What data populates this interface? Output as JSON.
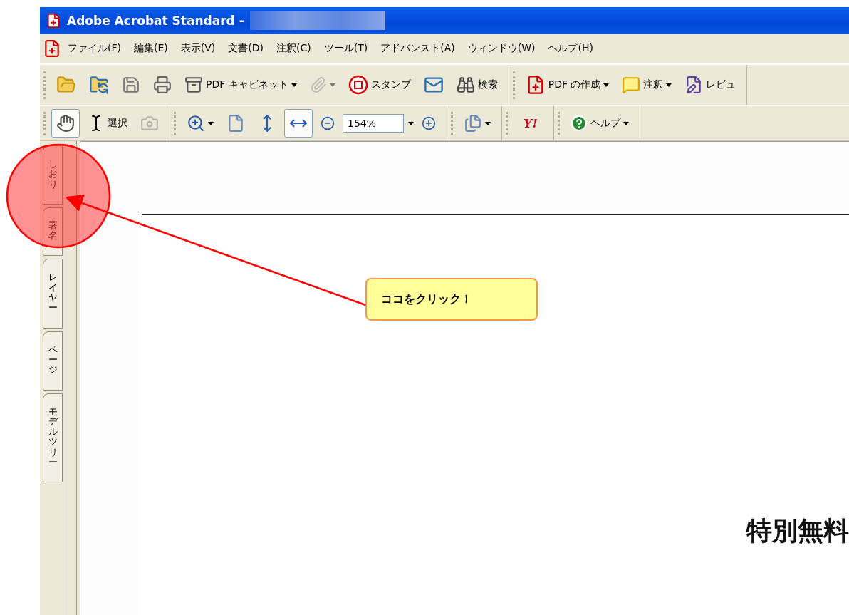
{
  "window": {
    "title": "Adobe Acrobat Standard -"
  },
  "menu": [
    "ファイル(F)",
    "編集(E)",
    "表示(V)",
    "文書(D)",
    "注釈(C)",
    "ツール(T)",
    "アドバンスト(A)",
    "ウィンドウ(W)",
    "ヘルプ(H)"
  ],
  "toolbar_1": [
    {
      "items": [
        {
          "kind": "button"
        },
        {
          "kind": "button"
        },
        {
          "kind": "button"
        },
        {
          "kind": "button"
        },
        {
          "kind": "button",
          "label": "PDF キャビネット",
          "dropdown": true
        },
        {
          "kind": "button",
          "dropdown": true,
          "disabled": true
        },
        {
          "kind": "button",
          "label": "スタンプ"
        },
        {
          "kind": "button"
        },
        {
          "kind": "button",
          "label": "検索"
        }
      ]
    },
    {
      "items": [
        {
          "kind": "button",
          "label": "PDF の作成",
          "dropdown": true
        },
        {
          "kind": "button",
          "label": "注釈",
          "dropdown": true
        },
        {
          "kind": "button",
          "label": "レビュ"
        }
      ]
    }
  ],
  "toolbar_2": [
    {
      "items": [
        {
          "kind": "button",
          "selected": true
        },
        {
          "kind": "button",
          "label": "選択",
          "selected": false
        },
        {
          "kind": "button",
          "disabled": true
        }
      ]
    },
    {
      "items": [
        {
          "kind": "button",
          "dropdown": true
        },
        {
          "kind": "button",
          "selected": false
        },
        {
          "kind": "button",
          "selected": false
        },
        {
          "kind": "button",
          "selected": true
        },
        {
          "kind": "button"
        },
        {
          "kind": "field",
          "value": "154%",
          "dropdown": true
        },
        {
          "kind": "button"
        }
      ]
    },
    {
      "items": [
        {
          "kind": "button",
          "dropdown": true
        }
      ]
    },
    {
      "items": [
        {
          "kind": "logo",
          "label": "Y!"
        }
      ]
    },
    {
      "items": [
        {
          "kind": "button",
          "label": "ヘルプ",
          "dropdown": true
        }
      ]
    }
  ],
  "nav_tabs": [
    "しおり",
    "署名",
    "レイヤー",
    "ページ",
    "モデルツリー"
  ],
  "document": {
    "heading": "特別無料"
  },
  "annotation": {
    "callout": "ココをクリック！"
  }
}
